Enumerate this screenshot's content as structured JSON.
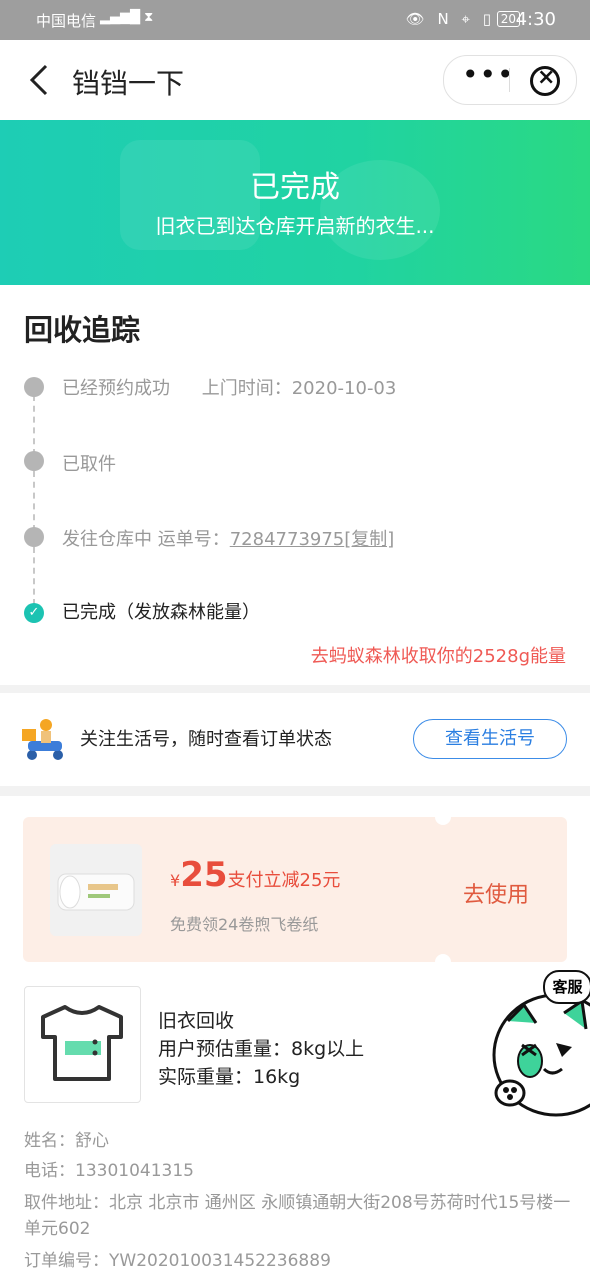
{
  "status_bar": {
    "carrier": "中国电信",
    "battery": "20",
    "time": "4:30"
  },
  "nav": {
    "title": "铛铛一下"
  },
  "banner": {
    "status": "已完成",
    "subtitle": "旧衣已到达仓库开启新的衣生..."
  },
  "tracking": {
    "heading": "回收追踪",
    "steps": [
      {
        "label": "已经预约成功",
        "extra": "上门时间：2020-10-03"
      },
      {
        "label": "已取件"
      },
      {
        "label": "发往仓库中 运单号：",
        "waybill": "7284773975",
        "copy": "[复制]"
      },
      {
        "label": "已完成（发放森林能量）"
      }
    ],
    "forest_link": "去蚂蚁森林收取你的2528g能量"
  },
  "follow": {
    "text": "关注生活号，随时查看订单状态",
    "button": "查看生活号"
  },
  "coupon": {
    "yen": "¥",
    "amount": "25",
    "desc": "支付立减25元",
    "free_text": "免费领24卷煦飞卷纸",
    "use_button": "去使用"
  },
  "item": {
    "name": "旧衣回收",
    "est_weight": "用户预估重量：8kg以上",
    "actual_weight": "实际重量：16kg"
  },
  "customer": {
    "name": "姓名：舒心",
    "phone": "电话：13301041315",
    "address": "取件地址：北京 北京市 通州区 永顺镇通朝大街208号苏荷时代15号楼一单元602",
    "order": "订单编号：YW202010031452236889"
  },
  "service": {
    "label": "客服"
  },
  "colors": {
    "banner_start": "#1ecdb5",
    "banner_end": "#2ad983",
    "accent_red": "#ef5a55",
    "link_blue": "#2a7ee1",
    "check_teal": "#1cc3b2"
  }
}
